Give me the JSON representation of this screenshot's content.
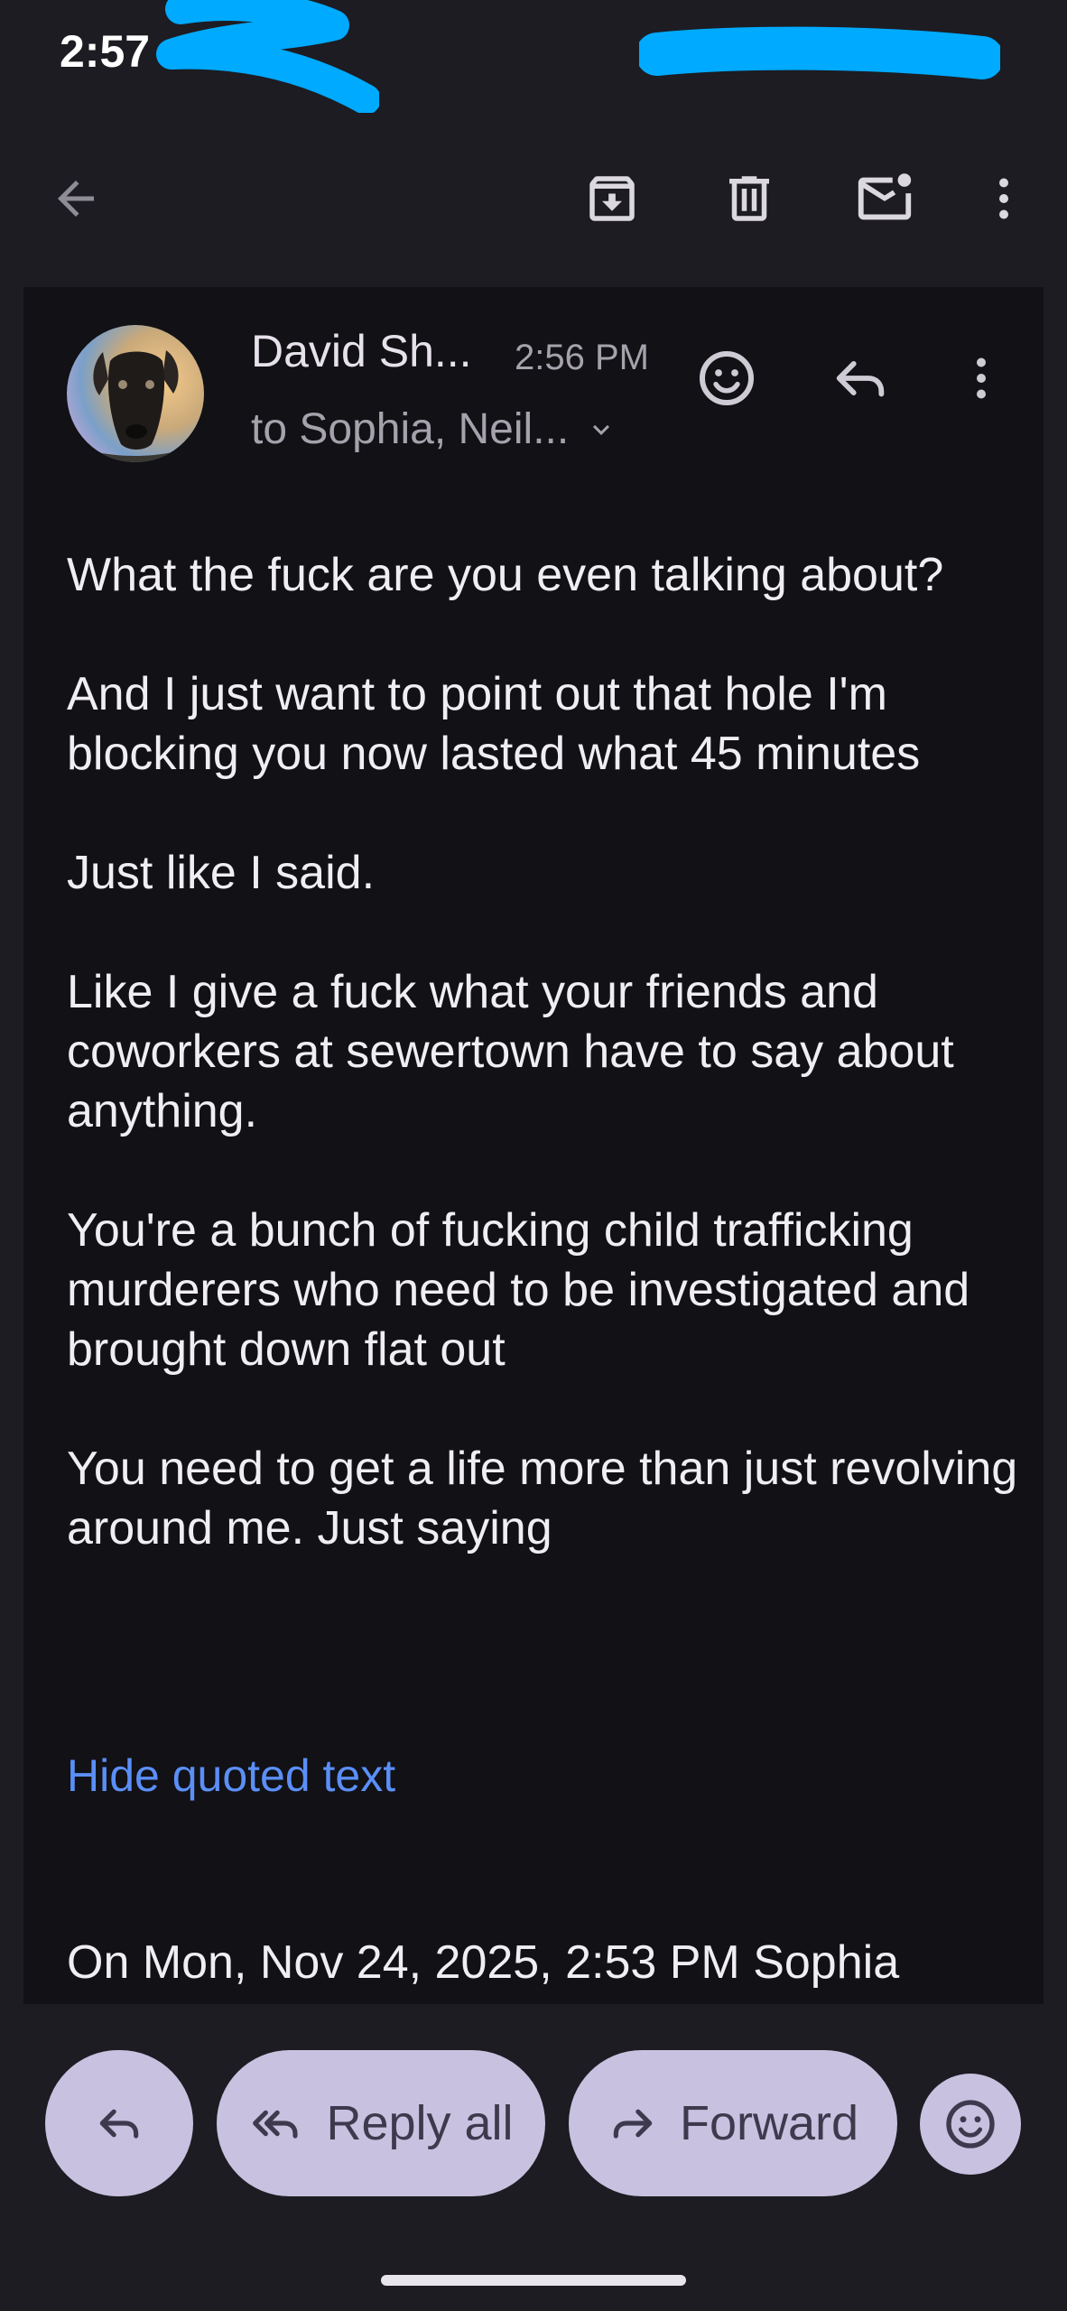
{
  "status_bar": {
    "time": "2:57"
  },
  "toolbar": {
    "back_icon": "arrow-back-icon",
    "archive_icon": "archive-icon",
    "delete_icon": "trash-icon",
    "unread_icon": "mark-unread-icon",
    "more_icon": "more-vert-icon"
  },
  "message": {
    "sender": "David Sh...",
    "time": "2:56 PM",
    "recipients": "to Sophia, Neil...",
    "paragraphs": [
      "What the fuck are you even talking about?",
      "And I just want to point out that hole I'm blocking you now lasted what 45 minutes",
      "Just like I said.",
      "Like I give a fuck what your friends and coworkers at sewertown have to say about anything.",
      "You're a bunch of fucking child trafficking murderers who need to be investigated and brought down flat out",
      "You need to get a life more than just revolving around me. Just saying"
    ],
    "hide_quoted_label": "Hide quoted text",
    "quote_header": "On Mon, Nov 24, 2025, 2:53 PM Sophia"
  },
  "actions": {
    "reply_all_label": "Reply all",
    "forward_label": "Forward"
  },
  "colors": {
    "background": "#1c1c22",
    "card": "#111116",
    "pill": "#c9c1e0",
    "link": "#5b8ff7",
    "redaction": "#00aaff"
  }
}
